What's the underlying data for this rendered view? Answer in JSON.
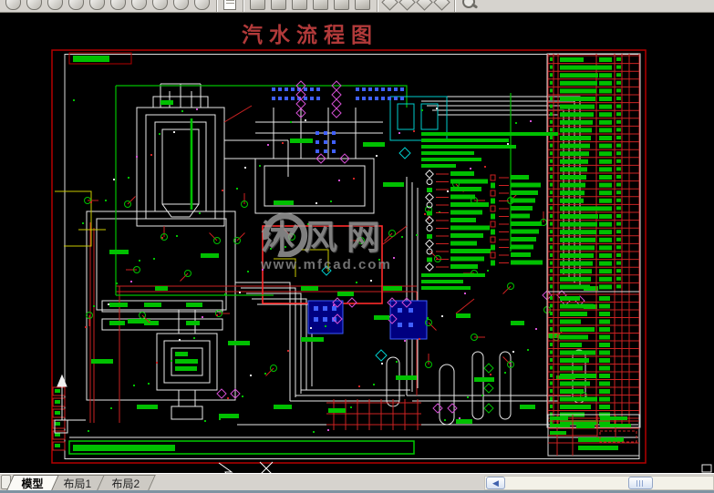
{
  "title": {
    "text": "汽水流程图"
  },
  "watermark": {
    "brand": "沐风网",
    "url": "www.mfcad.com"
  },
  "sheet_tabs": [
    {
      "label": "模型",
      "active": true
    },
    {
      "label": "布局1",
      "active": false
    },
    {
      "label": "布局2",
      "active": false
    }
  ],
  "palette": {
    "canvas_bg": "#000000",
    "title_red": "#b23a3a",
    "frame_red": "#b40000",
    "selection_red": "#ff2a2a",
    "cad_white": "#e8e8e8",
    "cad_green": "#00d400",
    "cad_magenta": "#d24fd2",
    "cad_cyan": "#00cccc",
    "cad_blue": "#3c5cff",
    "cad_yellow": "#c8c800",
    "toolbar_bg": "#d6d3ce",
    "statusbar": "#7f93a2"
  },
  "drawing": {
    "equipment_table": {
      "upper_rows": 30,
      "lower_rows": 17
    },
    "legend": {
      "note_lines": 6,
      "items_col1": 13,
      "items_col2": 12,
      "footer_lines": 3
    },
    "callout_count": 30,
    "scatter_count": 110
  },
  "toolbar": {
    "icon_types": [
      "cyl",
      "cyl",
      "cyl",
      "cyl",
      "cyl",
      "cyl",
      "cyl",
      "cyl",
      "cyl",
      "cyl",
      "sheet",
      "box",
      "box",
      "box",
      "box",
      "box",
      "box",
      "dia",
      "dia",
      "dia",
      "dia",
      "mag"
    ]
  }
}
